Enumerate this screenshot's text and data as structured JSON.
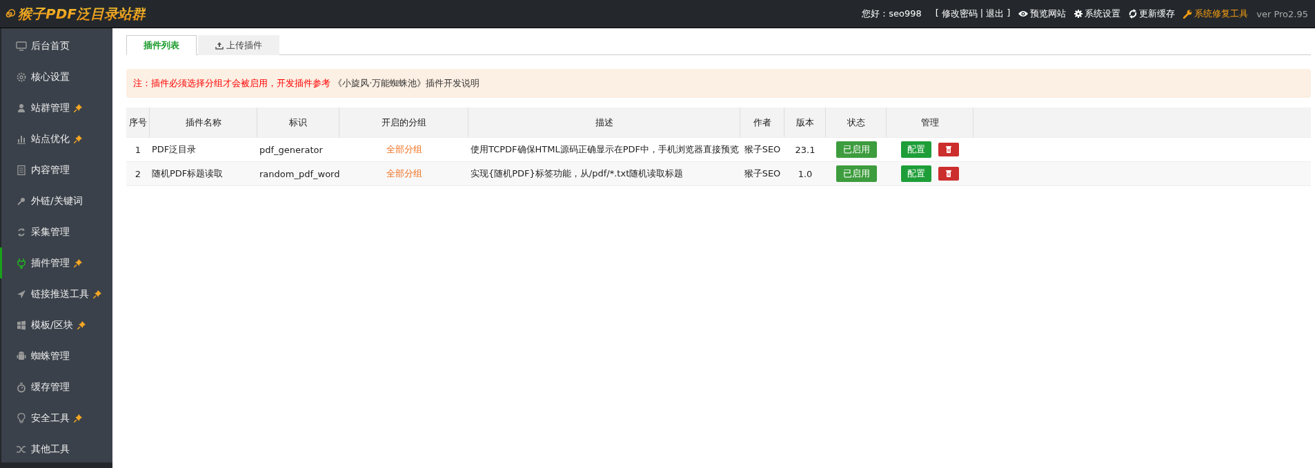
{
  "header": {
    "logo": "猴子PDF泛目录站群",
    "greeting": "您好：seo998",
    "account_open": "[",
    "account_separator": "|",
    "account_close": "]",
    "account_links": [
      {
        "label": "修改密码"
      },
      {
        "label": "退出"
      }
    ],
    "nav": [
      {
        "label": "预览网站",
        "kind": "eye",
        "warning": false
      },
      {
        "label": "系统设置",
        "kind": "gear",
        "warning": false
      },
      {
        "label": "更新缓存",
        "kind": "refresh",
        "warning": false
      },
      {
        "label": "系统修复工具",
        "kind": "wrench",
        "warning": true
      }
    ],
    "version": "ver Pro2.95"
  },
  "sidebar": {
    "items": [
      {
        "label": "后台首页",
        "pinned": false,
        "selected": false
      },
      {
        "label": "核心设置",
        "pinned": false,
        "selected": false
      },
      {
        "label": "站群管理",
        "pinned": true,
        "selected": false
      },
      {
        "label": "站点优化",
        "pinned": true,
        "selected": false
      },
      {
        "label": "内容管理",
        "pinned": false,
        "selected": false
      },
      {
        "label": "外链/关键词",
        "pinned": false,
        "selected": false
      },
      {
        "label": "采集管理",
        "pinned": false,
        "selected": false
      },
      {
        "label": "插件管理",
        "pinned": true,
        "selected": true
      },
      {
        "label": "链接推送工具",
        "pinned": true,
        "selected": false
      },
      {
        "label": "模板/区块",
        "pinned": true,
        "selected": false
      },
      {
        "label": "蜘蛛管理",
        "pinned": false,
        "selected": false
      },
      {
        "label": "缓存管理",
        "pinned": false,
        "selected": false
      },
      {
        "label": "安全工具",
        "pinned": true,
        "selected": false
      },
      {
        "label": "其他工具",
        "pinned": false,
        "selected": false
      }
    ]
  },
  "tabs": [
    {
      "label": "插件列表",
      "selected": true,
      "kind": "plain"
    },
    {
      "label": "上传插件",
      "selected": false,
      "kind": "upload"
    }
  ],
  "notice": {
    "warning": "注：插件必须选择分组才会被启用，开发插件参考",
    "link": "《小旋风·万能蜘蛛池》插件开发说明"
  },
  "table": {
    "columns": [
      "序号",
      "插件名称",
      "标识",
      "开启的分组",
      "描述",
      "作者",
      "版本",
      "状态",
      "管理"
    ],
    "rows": [
      {
        "index": "1",
        "name": "PDF泛目录",
        "id": "pdf_generator",
        "groups": "全部分组",
        "description": "使用TCPDF确保HTML源码正确显示在PDF中，手机浏览器直接预览",
        "author": "猴子SEO",
        "version": "23.1",
        "status": "已启用",
        "enabled": true,
        "config": "配置"
      },
      {
        "index": "2",
        "name": "随机PDF标题读取",
        "id": "random_pdf_word",
        "groups": "全部分组",
        "description": "实现{随机PDF}标签功能，从/pdf/*.txt随机读取标题",
        "author": "猴子SEO",
        "version": "1.0",
        "status": "已启用",
        "enabled": true,
        "config": "配置"
      }
    ]
  }
}
